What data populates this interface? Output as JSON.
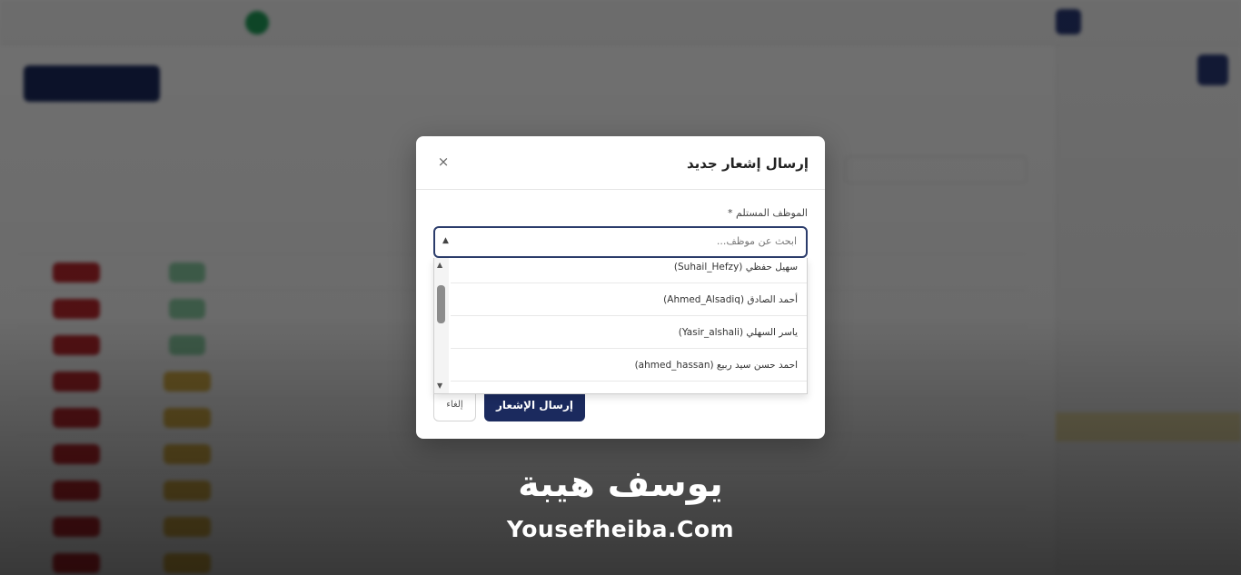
{
  "modal": {
    "title": "إرسال إشعار جديد",
    "close_glyph": "×",
    "field_label": "الموظف المستلم *",
    "search_placeholder": "ابحث عن موظف...",
    "caret_glyph": "▲",
    "send_label": "إرسال الإشعار",
    "cancel_label": "إلغاء"
  },
  "dropdown": {
    "items": [
      {
        "label": "سهيل حفظي (Suhail_Hefzy)"
      },
      {
        "label": "أحمد الصادق (Ahmed_Alsadiq)"
      },
      {
        "label": "ياسر السهلي (Yasir_alshali)"
      },
      {
        "label": "احمد حسن سيد ربيع (ahmed_hassan)"
      }
    ],
    "scroll_up_glyph": "▲",
    "scroll_down_glyph": "▼"
  },
  "watermark": {
    "arabic": "يوسف هيبة",
    "english": "Yousefheiba.Com"
  },
  "icons": {
    "close": "close-icon",
    "caret": "caret-up-icon"
  },
  "colors": {
    "primary": "#1b2a5e",
    "active_sidebar": "#f4e7b0",
    "danger": "#c0282e",
    "success": "#1f9e59",
    "warning": "#e0b64a"
  }
}
